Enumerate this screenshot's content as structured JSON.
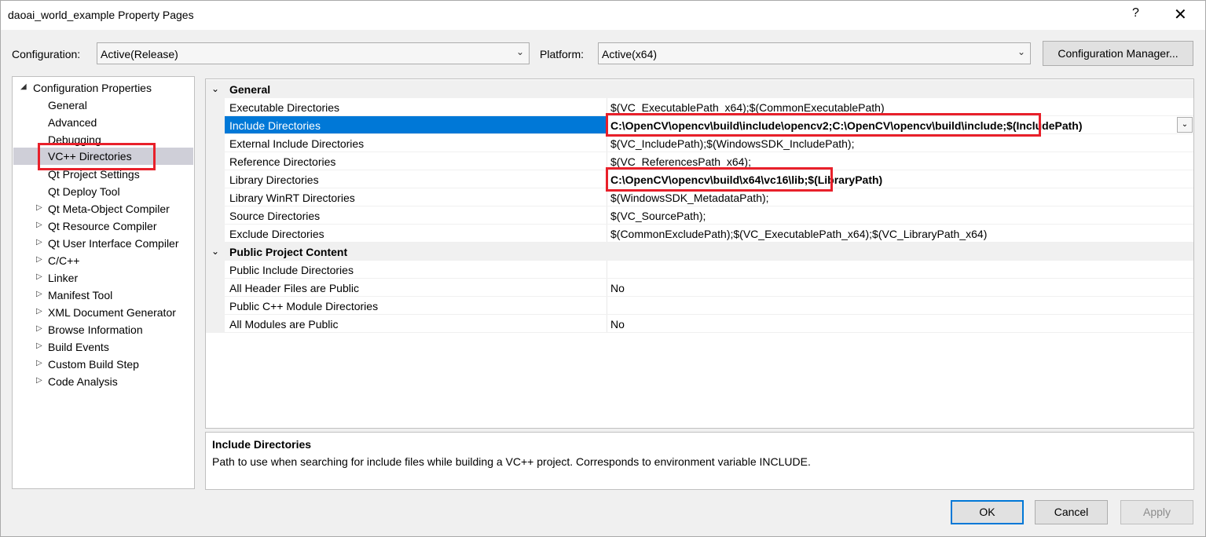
{
  "window": {
    "title": "daoai_world_example Property Pages",
    "help": "?",
    "close": "✕"
  },
  "toolbar": {
    "configuration_label": "Configuration:",
    "configuration_value": "Active(Release)",
    "platform_label": "Platform:",
    "platform_value": "Active(x64)",
    "config_manager": "Configuration Manager..."
  },
  "tree": {
    "root": "Configuration Properties",
    "items": [
      "General",
      "Advanced",
      "Debugging",
      "VC++ Directories",
      "Qt Project Settings",
      "Qt Deploy Tool",
      "Qt Meta-Object Compiler",
      "Qt Resource Compiler",
      "Qt User Interface Compiler",
      "C/C++",
      "Linker",
      "Manifest Tool",
      "XML Document Generator",
      "Browse Information",
      "Build Events",
      "Custom Build Step",
      "Code Analysis"
    ],
    "selected": "VC++ Directories"
  },
  "grid": {
    "categories": [
      "General",
      "Public Project Content"
    ],
    "general": [
      {
        "name": "Executable Directories",
        "value": "$(VC_ExecutablePath_x64);$(CommonExecutablePath)"
      },
      {
        "name": "Include Directories",
        "value": "C:\\OpenCV\\opencv\\build\\include\\opencv2;C:\\OpenCV\\opencv\\build\\include;$(IncludePath)"
      },
      {
        "name": "External Include Directories",
        "value": "$(VC_IncludePath);$(WindowsSDK_IncludePath);"
      },
      {
        "name": "Reference Directories",
        "value": "$(VC_ReferencesPath_x64);"
      },
      {
        "name": "Library Directories",
        "value": "C:\\OpenCV\\opencv\\build\\x64\\vc16\\lib;$(LibraryPath)"
      },
      {
        "name": "Library WinRT Directories",
        "value": "$(WindowsSDK_MetadataPath);"
      },
      {
        "name": "Source Directories",
        "value": "$(VC_SourcePath);"
      },
      {
        "name": "Exclude Directories",
        "value": "$(CommonExcludePath);$(VC_ExecutablePath_x64);$(VC_LibraryPath_x64)"
      }
    ],
    "public": [
      {
        "name": "Public Include Directories",
        "value": ""
      },
      {
        "name": "All Header Files are Public",
        "value": "No"
      },
      {
        "name": "Public C++ Module Directories",
        "value": ""
      },
      {
        "name": "All Modules are Public",
        "value": "No"
      }
    ]
  },
  "description": {
    "title": "Include Directories",
    "text": "Path to use when searching for include files while building a VC++ project.  Corresponds to environment variable INCLUDE."
  },
  "buttons": {
    "ok": "OK",
    "cancel": "Cancel",
    "apply": "Apply"
  },
  "colors": {
    "selection": "#0078d7",
    "highlight_box": "#e8202a"
  }
}
